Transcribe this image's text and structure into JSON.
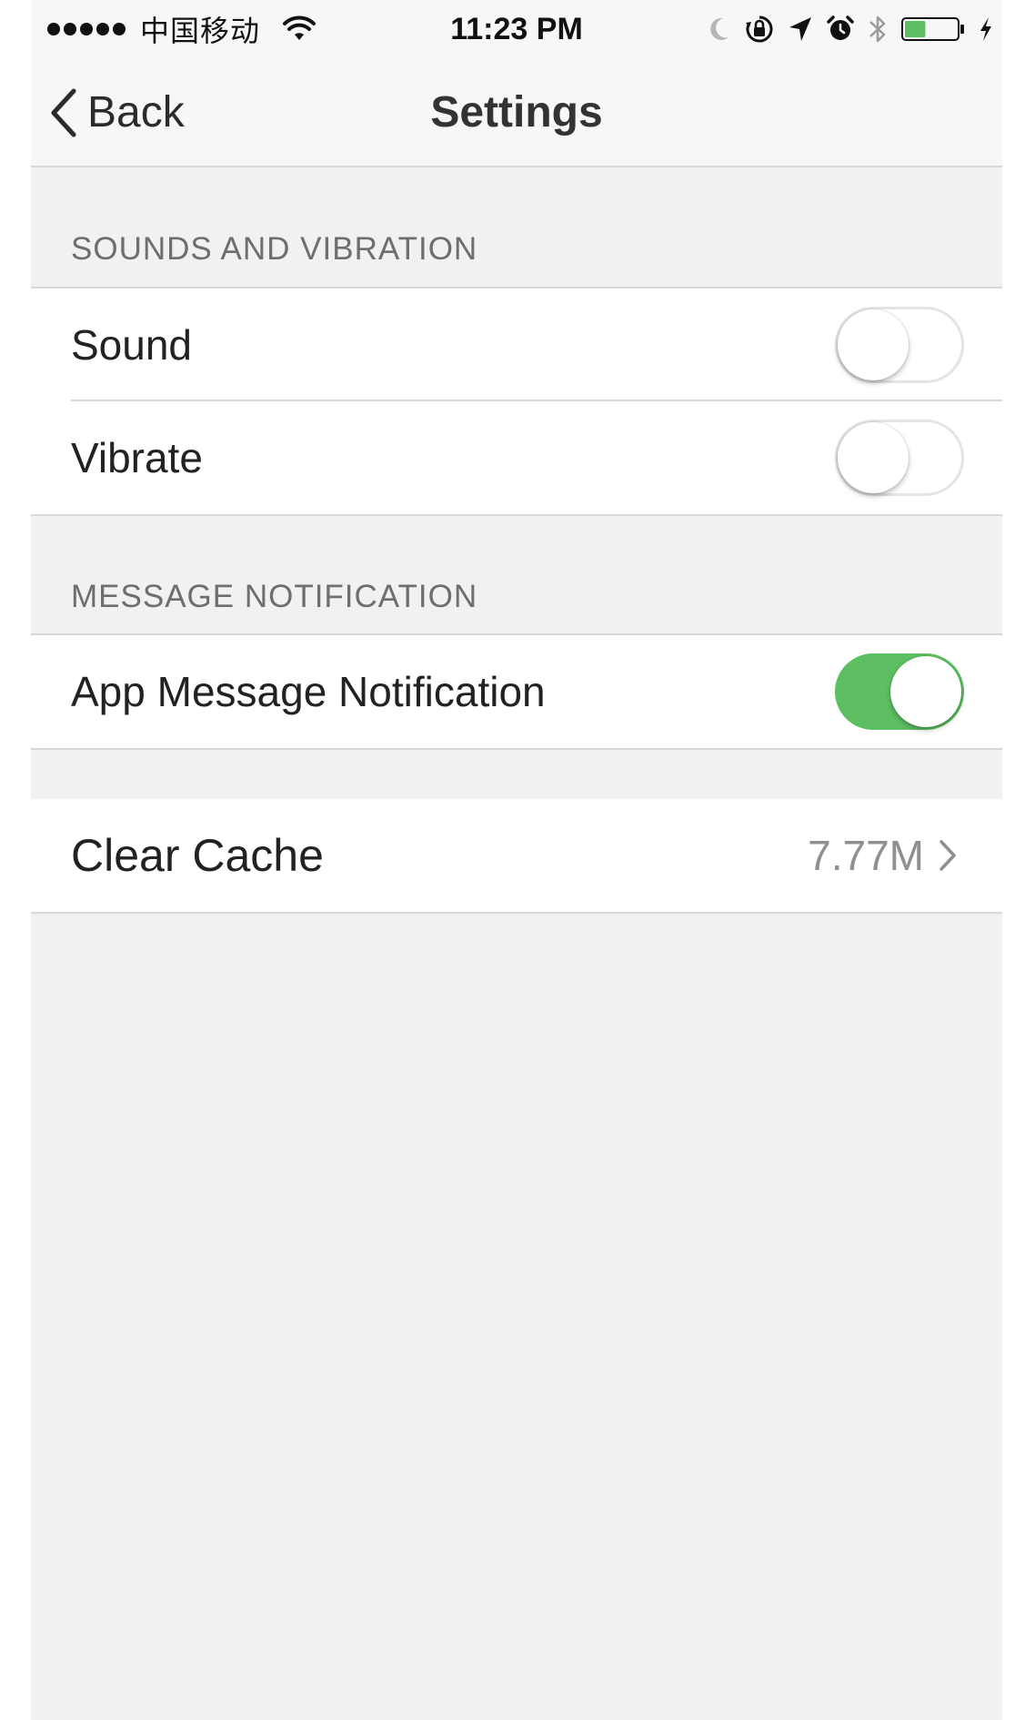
{
  "status_bar": {
    "signal_bars": 5,
    "carrier": "中国移动",
    "time": "11:23 PM",
    "battery_level": 0.4,
    "icons": [
      "wifi-icon",
      "moon-icon",
      "rotation-lock-icon",
      "location-arrow-icon",
      "alarm-icon",
      "bluetooth-icon",
      "battery-icon",
      "charging-bolt-icon"
    ]
  },
  "nav": {
    "back_label": "Back",
    "title": "Settings",
    "back_icon": "chevron-left-icon"
  },
  "sections": {
    "sounds": {
      "header": "SOUNDS AND VIBRATION",
      "rows": [
        {
          "label": "Sound",
          "enabled": false
        },
        {
          "label": "Vibrate",
          "enabled": false
        }
      ]
    },
    "notifications": {
      "header": "MESSAGE NOTIFICATION",
      "rows": [
        {
          "label": "App Message Notification",
          "enabled": true
        }
      ]
    },
    "storage": {
      "rows": [
        {
          "label": "Clear Cache",
          "value": "7.77M",
          "icon": "chevron-right-icon"
        }
      ]
    }
  },
  "colors": {
    "toggle_on": "#5dbf61",
    "background": "#f1f1f2",
    "battery_fill": "#5dbf61"
  }
}
